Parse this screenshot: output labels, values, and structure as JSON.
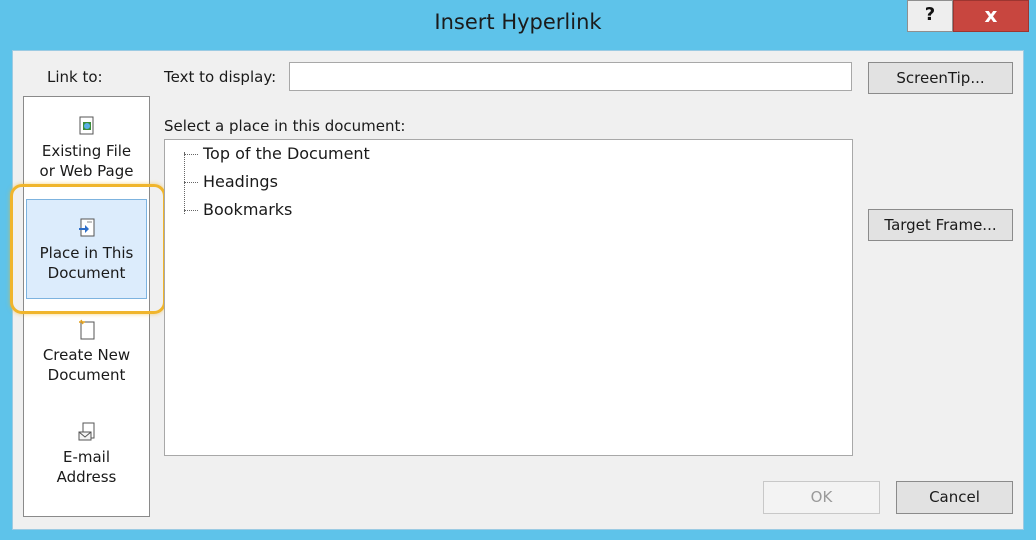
{
  "window": {
    "title": "Insert Hyperlink",
    "help_label": "?",
    "close_label": "x"
  },
  "link_to": {
    "label": "Link to:",
    "items": [
      {
        "line1": "Existing File",
        "line2": "or Web Page",
        "icon": "existing-file-icon"
      },
      {
        "line1": "Place in This",
        "line2": "Document",
        "icon": "place-in-document-icon",
        "selected": true
      },
      {
        "line1": "Create New",
        "line2": "Document",
        "icon": "create-new-document-icon"
      },
      {
        "line1": "E-mail",
        "line2": "Address",
        "icon": "email-address-icon"
      }
    ]
  },
  "text_to_display": {
    "label": "Text to display:",
    "value": ""
  },
  "buttons": {
    "screentip": "ScreenTip...",
    "target_frame": "Target Frame...",
    "ok": "OK",
    "cancel": "Cancel"
  },
  "place_list": {
    "label": "Select a place in this document:",
    "items": [
      "Top of the Document",
      "Headings",
      "Bookmarks"
    ]
  },
  "colors": {
    "title_bar": "#5ec3ea",
    "close_button": "#c8463f",
    "selection_highlight": "#f0b52c",
    "selected_item_bg": "#dcecfc"
  }
}
